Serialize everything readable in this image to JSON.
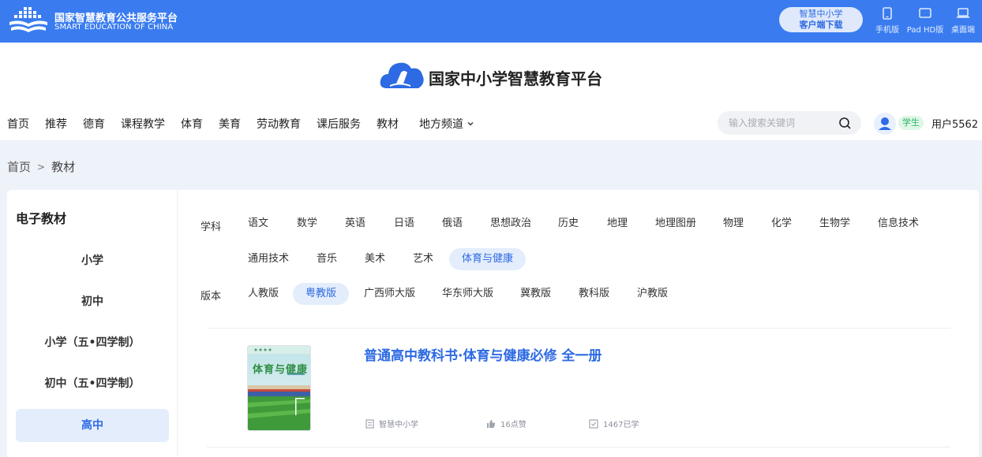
{
  "topbar": {
    "brand_cn": "国家智慧教育公共服务平台",
    "brand_en": "SMART EDUCATION OF CHINA",
    "app_download_line1": "智慧中小学",
    "app_download_line2": "客户端下载",
    "devices": [
      {
        "label": "手机版",
        "icon": "phone-icon"
      },
      {
        "label": "Pad HD版",
        "icon": "tablet-icon"
      },
      {
        "label": "桌面端",
        "icon": "laptop-icon"
      }
    ]
  },
  "header": {
    "site_title": "国家中小学智慧教育平台",
    "nav": [
      "首页",
      "推荐",
      "德育",
      "课程教学",
      "体育",
      "美育",
      "劳动教育",
      "课后服务",
      "教材",
      "地方频道"
    ],
    "search_placeholder": "输入搜索关键词",
    "role_badge": "学生",
    "username": "用户5562"
  },
  "breadcrumb": {
    "home": "首页",
    "separator": ">",
    "current": "教材"
  },
  "sidebar": {
    "title": "电子教材",
    "items": [
      "小学",
      "初中",
      "小学（五•四学制）",
      "初中（五•四学制）",
      "高中"
    ],
    "active": "高中"
  },
  "filters": {
    "subject_label": "学科",
    "subjects_row1": [
      "语文",
      "数学",
      "英语",
      "日语",
      "俄语",
      "思想政治",
      "历史",
      "地理",
      "地理图册",
      "物理",
      "化学",
      "生物学",
      "信息技术"
    ],
    "subjects_row2": [
      "通用技术",
      "音乐",
      "美术",
      "艺术",
      "体育与健康"
    ],
    "active_subject": "体育与健康",
    "edition_label": "版本",
    "editions": [
      "人教版",
      "粤教版",
      "广西师大版",
      "华东师大版",
      "冀教版",
      "教科版",
      "沪教版"
    ],
    "active_edition": "粤教版"
  },
  "book": {
    "title": "普通高中教科书·体育与健康必修 全一册",
    "cover_text": "体育与健康",
    "publisher": "智慧中小学",
    "likes": "16点赞",
    "learners": "1467已学"
  },
  "colors": {
    "brand_blue": "#3a7cf0",
    "link_blue": "#2d6ae3",
    "active_bg": "#e4edfc",
    "page_bg": "#eef2f9"
  }
}
